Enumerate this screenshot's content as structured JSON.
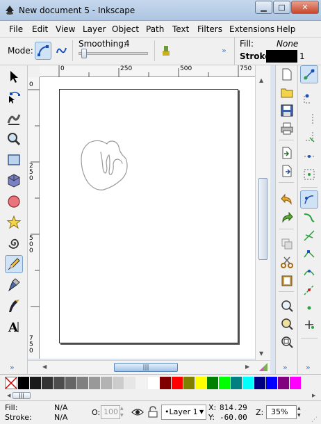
{
  "window": {
    "title": "New document 5 - Inkscape",
    "buttons": {
      "minimize": "▁",
      "maximize": "□",
      "close": "✕"
    }
  },
  "menu": [
    "File",
    "Edit",
    "View",
    "Layer",
    "Object",
    "Path",
    "Text",
    "Filters",
    "Extensions",
    "Help"
  ],
  "tool_controls": {
    "mode_label": "Mode:",
    "smoothing_label": "Smoothing:",
    "smoothing_value": "4",
    "fill_label": "Fill:",
    "fill_value": "None",
    "stroke_label": "Stroke:",
    "stroke_width": "1",
    "more": "»"
  },
  "rulers": {
    "h_ticks": [
      "0",
      "250",
      "500",
      "750"
    ],
    "v_ticks": [
      "0",
      "2\n5\n0",
      "5\n0\n0",
      "7\n5\n0"
    ]
  },
  "left_tools": [
    {
      "icon": "selector-arrow-icon"
    },
    {
      "icon": "node-edit-icon"
    },
    {
      "icon": "tweak-icon"
    },
    {
      "icon": "zoom-icon"
    },
    {
      "icon": "rectangle-icon"
    },
    {
      "icon": "3d-box-icon"
    },
    {
      "icon": "ellipse-icon"
    },
    {
      "icon": "star-icon"
    },
    {
      "icon": "spiral-icon"
    },
    {
      "icon": "pencil-icon",
      "active": true
    },
    {
      "icon": "pen-icon"
    },
    {
      "icon": "calligraphy-icon"
    },
    {
      "icon": "text-icon"
    }
  ],
  "palette": {
    "colors": [
      "#000000",
      "#1a1a1a",
      "#333333",
      "#4d4d4d",
      "#666666",
      "#808080",
      "#999999",
      "#b3b3b3",
      "#cccccc",
      "#e6e6e6",
      "#f2f2f2",
      "#ffffff",
      "#800000",
      "#ff0000",
      "#808000",
      "#ffff00",
      "#008000",
      "#00ff00",
      "#008080",
      "#00ffff",
      "#000080",
      "#0000ff",
      "#800080",
      "#ff00ff"
    ]
  },
  "statusbar": {
    "fill_label": "Fill:",
    "fill_value": "N/A",
    "stroke_label": "Stroke:",
    "stroke_value": "N/A",
    "opacity_label": "O:",
    "opacity_value": "100",
    "layer_name": "•Layer 1",
    "x_label": "X:",
    "x_value": "814.29",
    "y_label": "Y:",
    "y_value": "-60.00",
    "zoom_label": "Z:",
    "zoom_value": "35%"
  }
}
